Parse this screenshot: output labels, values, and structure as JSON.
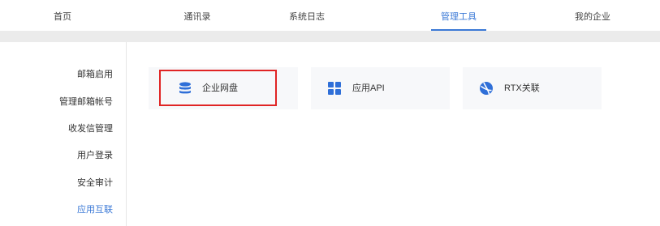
{
  "topnav": {
    "items": [
      {
        "label": "首页",
        "active": false
      },
      {
        "label": "通讯录",
        "active": false
      },
      {
        "label": "系统日志",
        "active": false
      },
      {
        "label": "管理工具",
        "active": true
      },
      {
        "label": "我的企业",
        "active": false
      }
    ]
  },
  "sidemenu": {
    "items": [
      {
        "label": "邮箱启用",
        "active": false
      },
      {
        "label": "管理邮箱帐号",
        "active": false
      },
      {
        "label": "收发信管理",
        "active": false
      },
      {
        "label": "用户登录",
        "active": false
      },
      {
        "label": "安全审计",
        "active": false
      },
      {
        "label": "应用互联",
        "active": true
      }
    ]
  },
  "apps": [
    {
      "label": "企业网盘",
      "icon": "database-icon",
      "highlighted": true
    },
    {
      "label": "应用API",
      "icon": "grid-icon",
      "highlighted": false
    },
    {
      "label": "RTX关联",
      "icon": "rtx-logo-icon",
      "highlighted": false
    }
  ],
  "colors": {
    "accent": "#3b79d6",
    "highlight": "#e02424",
    "card_bg": "#f7f8fa",
    "divider": "#ebebeb"
  }
}
